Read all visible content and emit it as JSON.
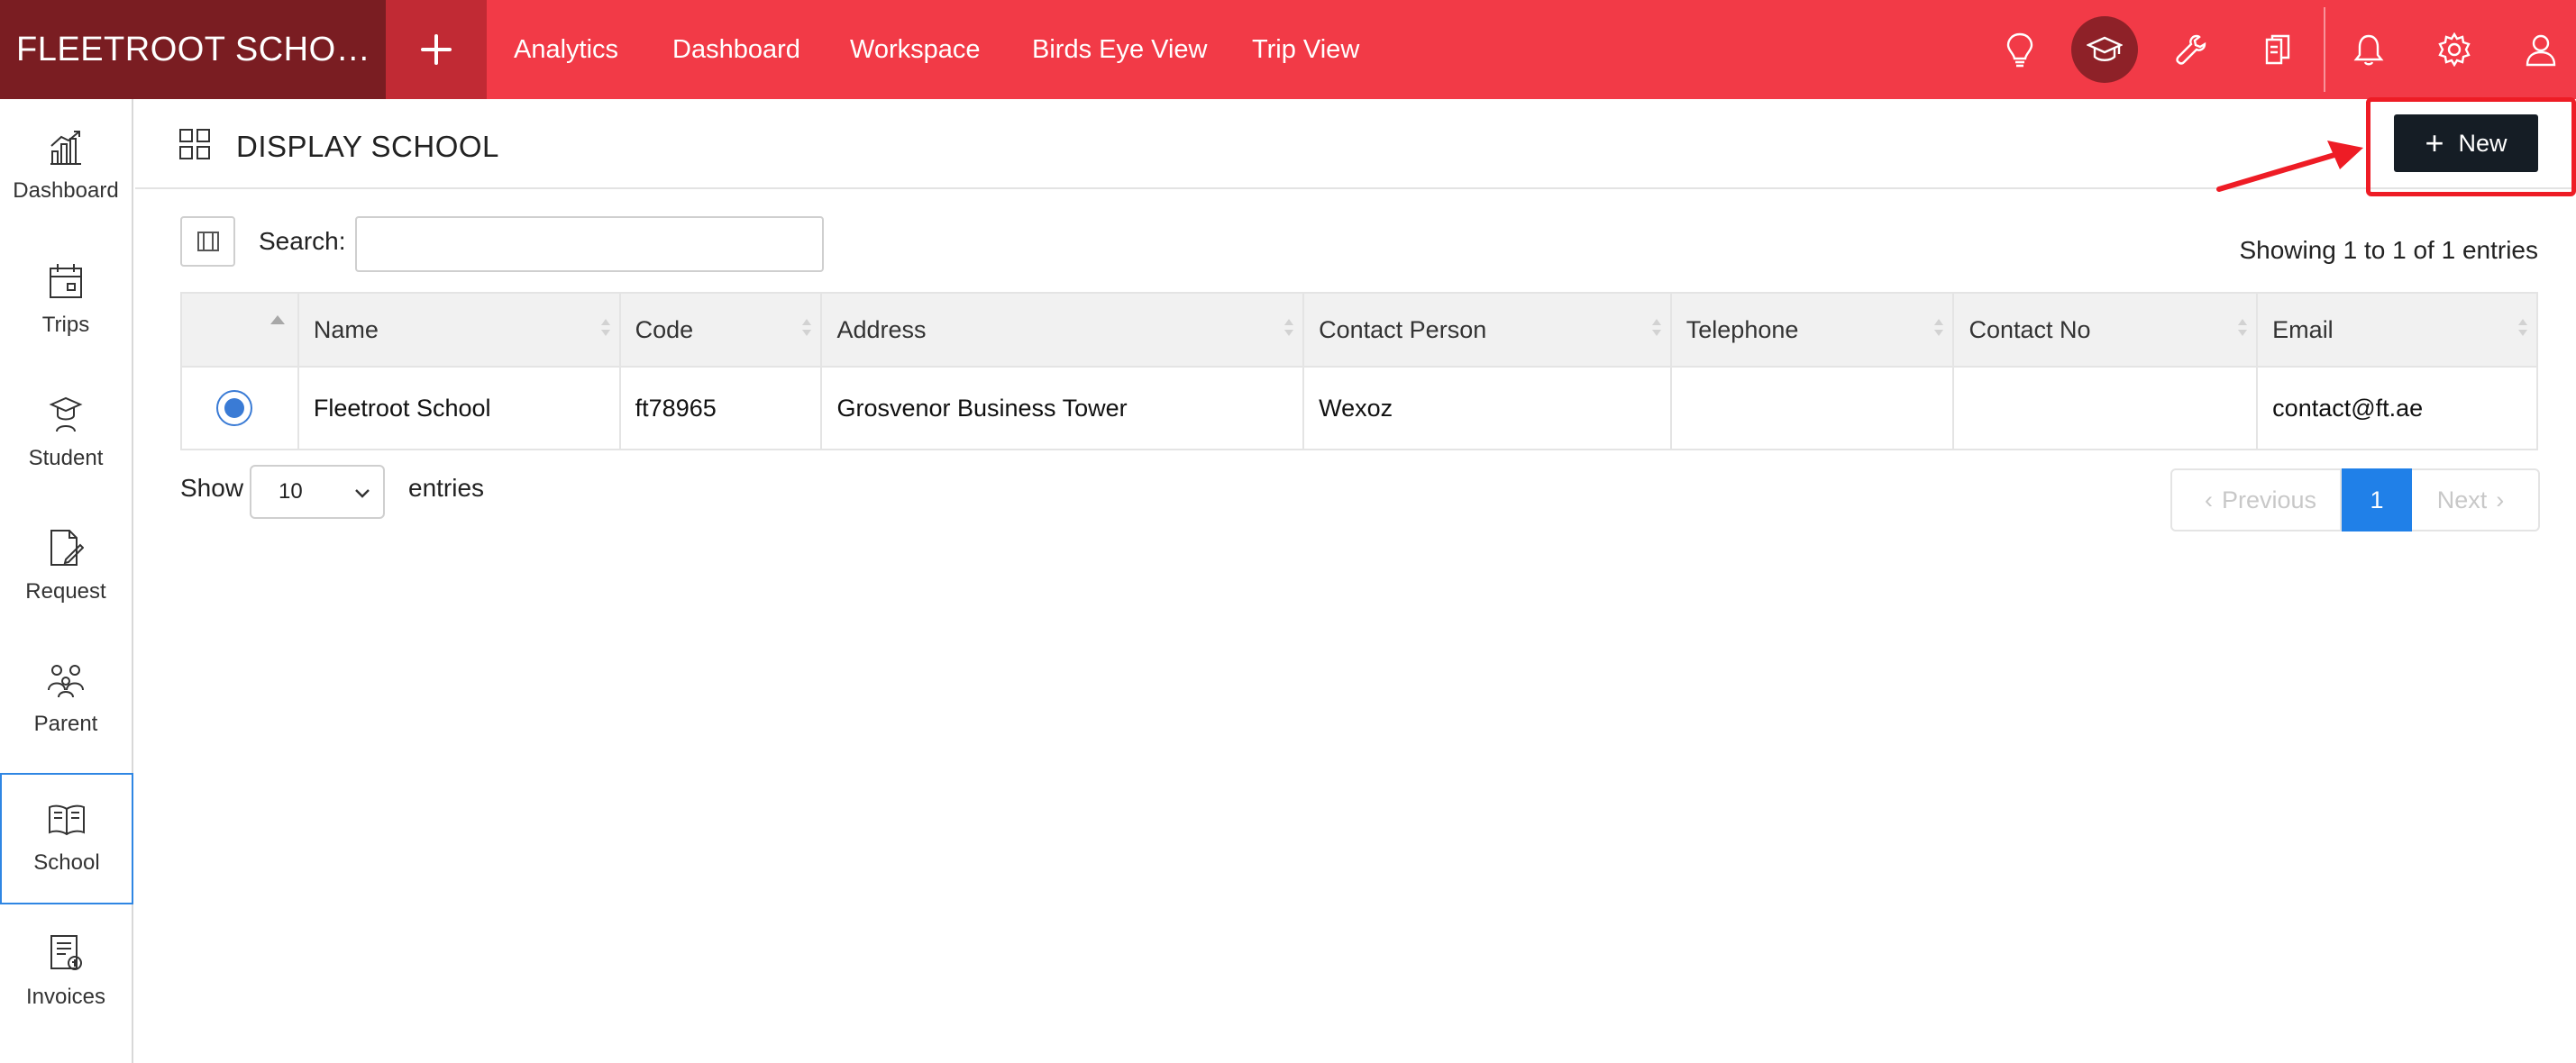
{
  "topbar": {
    "brand": "FLEETROOT SCHOO...",
    "nav": [
      "Analytics",
      "Dashboard",
      "Workspace",
      "Birds Eye View",
      "Trip View"
    ],
    "icons": [
      "lightbulb-icon",
      "graduation-cap-icon",
      "wrench-icon",
      "documents-icon",
      "bell-icon",
      "gear-icon",
      "user-icon"
    ],
    "accent": "#f23a47",
    "brand_bg": "#7a1d22"
  },
  "sidebar": {
    "items": [
      {
        "label": "Dashboard",
        "icon": "bar-chart-icon"
      },
      {
        "label": "Trips",
        "icon": "calendar-icon"
      },
      {
        "label": "Student",
        "icon": "student-icon"
      },
      {
        "label": "Request",
        "icon": "document-edit-icon"
      },
      {
        "label": "Parent",
        "icon": "family-icon"
      },
      {
        "label": "School",
        "icon": "open-book-icon"
      },
      {
        "label": "Invoices",
        "icon": "invoice-icon"
      }
    ],
    "active": "School"
  },
  "page": {
    "title": "DISPLAY SCHOOL",
    "new_button": "New"
  },
  "table_controls": {
    "search_label": "Search:",
    "search_value": "",
    "info": "Showing 1 to 1 of 1 entries",
    "show_label": "Show",
    "page_size": "10",
    "entries_label": "entries"
  },
  "table": {
    "columns": [
      "",
      "Name",
      "Code",
      "Address",
      "Contact Person",
      "Telephone",
      "Contact No",
      "Email"
    ],
    "rows": [
      {
        "selected": true,
        "name": "Fleetroot School",
        "code": "ft78965",
        "address": "Grosvenor Business Tower",
        "contact_person": "Wexoz",
        "telephone": "",
        "contact_no": "",
        "email": "contact@ft.ae"
      }
    ]
  },
  "pagination": {
    "previous": "Previous",
    "current": "1",
    "next": "Next"
  }
}
